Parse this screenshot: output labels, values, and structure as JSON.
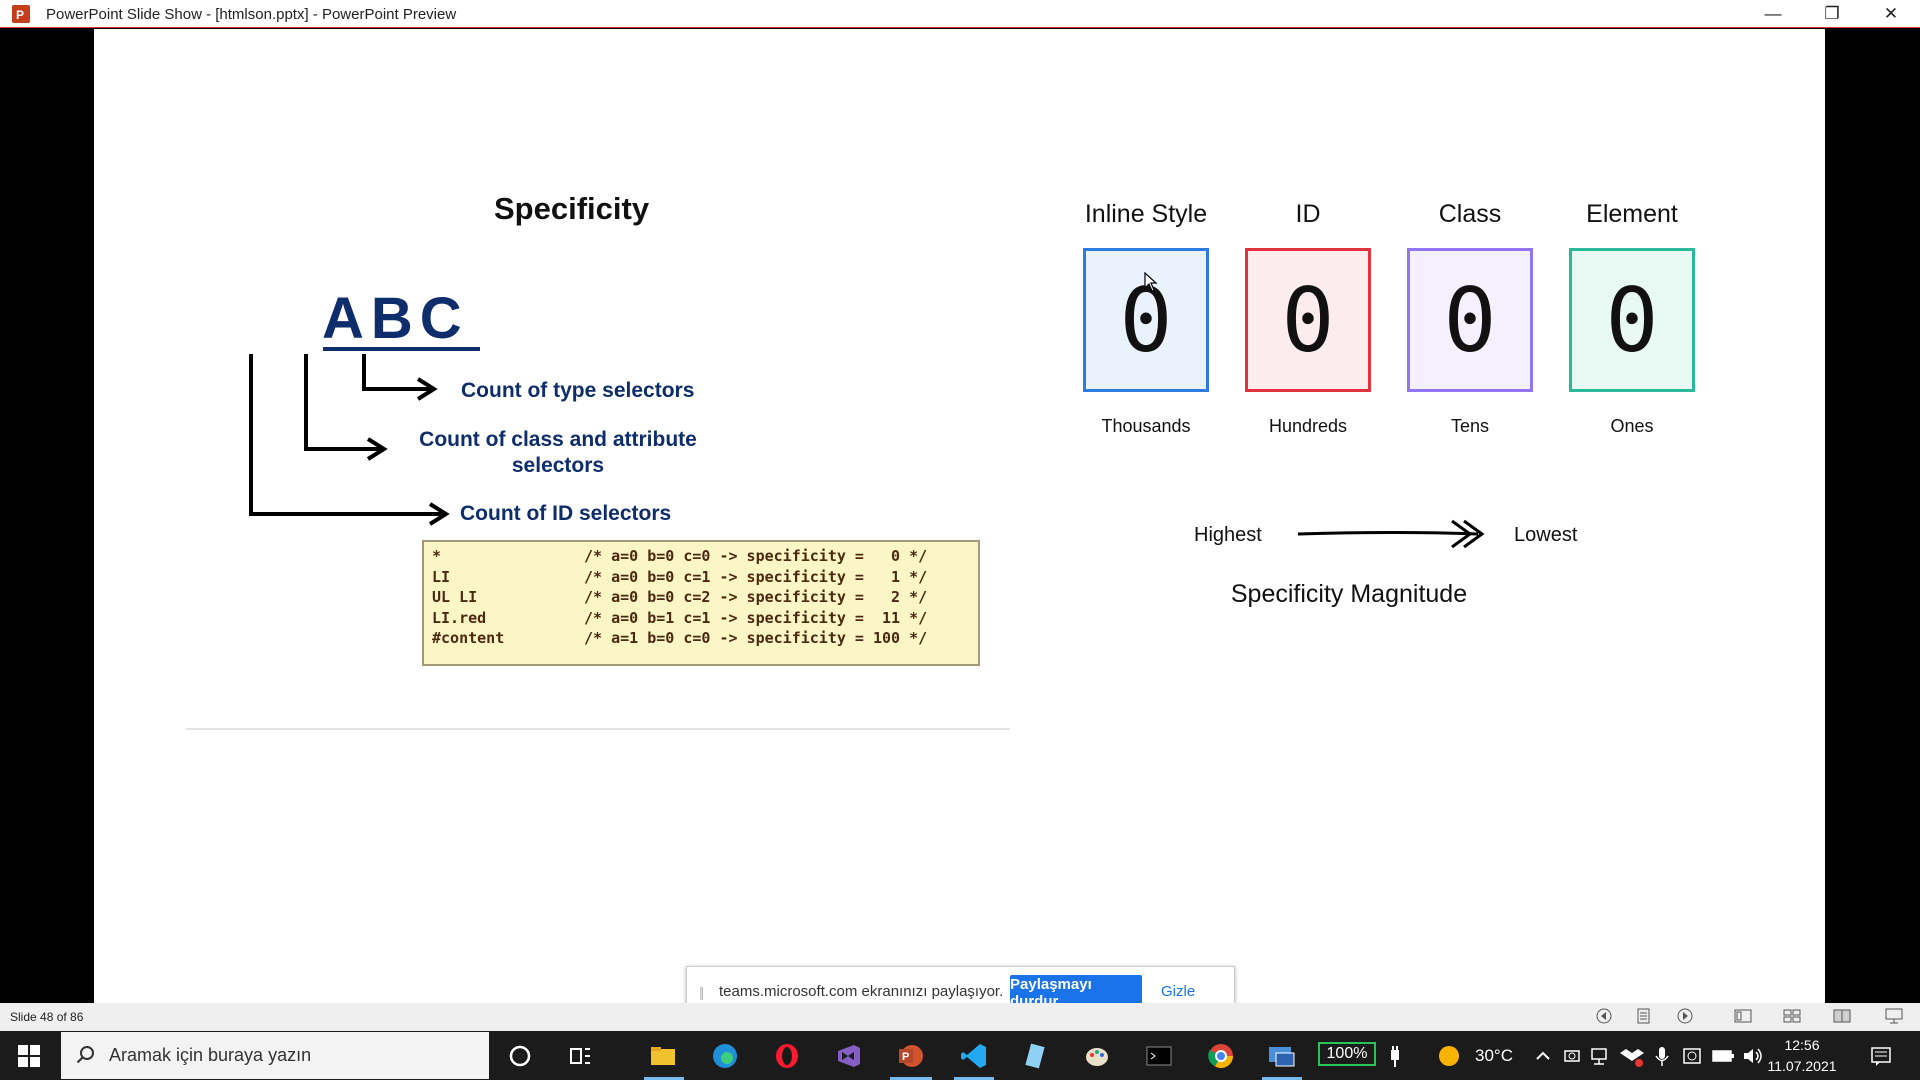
{
  "window": {
    "title": "PowerPoint Slide Show - [htmlson.pptx] - PowerPoint Preview",
    "controls": {
      "minimize": "—",
      "restore": "❐",
      "close": "✕"
    }
  },
  "slide": {
    "title": "Specificity",
    "abc": "ABC",
    "labels": {
      "type": "Count of type selectors",
      "class": "Count of class and attribute selectors",
      "id": "Count of ID selectors"
    },
    "code": [
      {
        "selector": "*",
        "comment": "/* a=0 b=0 c=0 -> specificity =   0 */"
      },
      {
        "selector": "LI",
        "comment": "/* a=0 b=0 c=1 -> specificity =   1 */"
      },
      {
        "selector": "UL LI",
        "comment": "/* a=0 b=0 c=2 -> specificity =   2 */"
      },
      {
        "selector": "LI.red",
        "comment": "/* a=0 b=1 c=1 -> specificity =  11 */"
      },
      {
        "selector": "#content",
        "comment": "/* a=1 b=0 c=0 -> specificity = 100 */"
      }
    ],
    "columns": [
      {
        "head": "Inline Style",
        "digit": "0",
        "sub": "Thousands",
        "color": "#2f7ae0"
      },
      {
        "head": "ID",
        "digit": "0",
        "sub": "Hundreds",
        "color": "#e2313f"
      },
      {
        "head": "Class",
        "digit": "0",
        "sub": "Tens",
        "color": "#9275f3"
      },
      {
        "head": "Element",
        "digit": "0",
        "sub": "Ones",
        "color": "#2ab99a"
      }
    ],
    "highest": "Highest",
    "lowest": "Lowest",
    "magnitude": "Specificity Magnitude"
  },
  "share_bar": {
    "text": "teams.microsoft.com ekranınızı paylaşıyor.",
    "stop_button": "Paylaşmayı durdur",
    "hide_link": "Gizle"
  },
  "statusbar": {
    "slide_number": "Slide 48 of 86"
  },
  "taskbar": {
    "search_placeholder": "Aramak için buraya yazın",
    "battery": "100%",
    "temperature": "30°C",
    "time": "12:56",
    "date": "11.07.2021"
  }
}
